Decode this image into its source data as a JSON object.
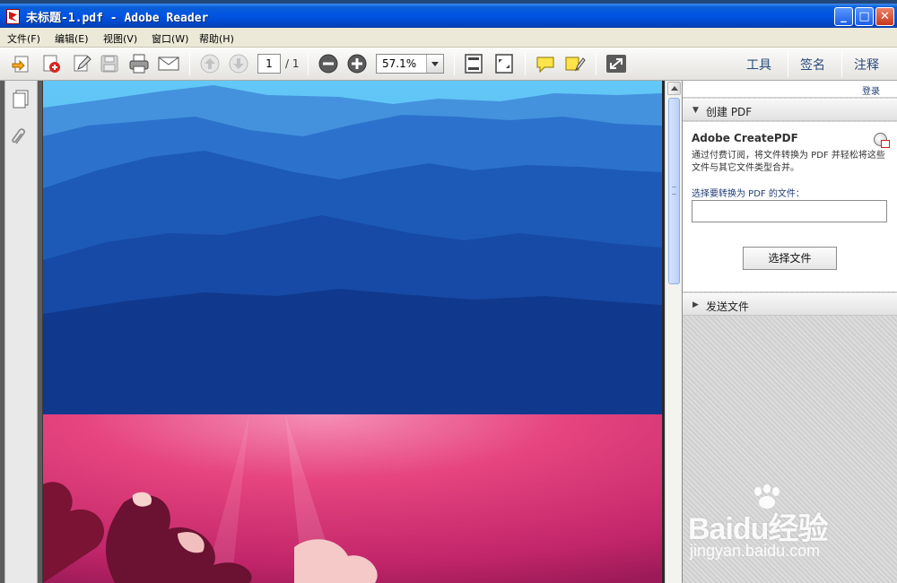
{
  "window": {
    "title": "未标题-1.pdf - Adobe Reader",
    "minimize_glyph": "_",
    "maximize_glyph": "□",
    "close_glyph": "✕"
  },
  "menu": {
    "items": [
      "文件(F)",
      "编辑(E)",
      "视图(V)",
      "窗口(W)",
      "帮助(H)"
    ]
  },
  "toolbar": {
    "current_page": "1",
    "page_total": "/ 1",
    "zoom": "57.1%",
    "right_buttons": [
      "工具",
      "签名",
      "注释"
    ],
    "icons": [
      "open-icon",
      "create-pdf-icon",
      "edit-icon",
      "save-icon",
      "print-icon",
      "email-icon",
      "prev-page-icon",
      "next-page-icon",
      "zoom-out-icon",
      "zoom-in-icon",
      "fit-page-icon",
      "fit-width-icon",
      "comment-icon",
      "highlight-icon",
      "fullscreen-icon"
    ]
  },
  "leftnav": {
    "icons": [
      "pages-icon",
      "attachments-icon"
    ]
  },
  "rightpane": {
    "login_label": "登录",
    "create_pdf": {
      "header": "创建 PDF",
      "title": "Adobe CreatePDF",
      "description": "通过付费订阅，将文件转换为 PDF 并轻松将这些文件与其它文件类型合并。",
      "prompt": "选择要转换为 PDF 的文件：",
      "button": "选择文件"
    },
    "send_files": {
      "header": "发送文件"
    }
  },
  "watermark": {
    "brand": "Baidu经验",
    "url": "jingyan.baidu.com"
  },
  "colors": {
    "titlebar": "#0054e3",
    "menubar": "#ece9d8",
    "mountain_sky": "#4fb6f2",
    "sunset": "#e6457f"
  }
}
